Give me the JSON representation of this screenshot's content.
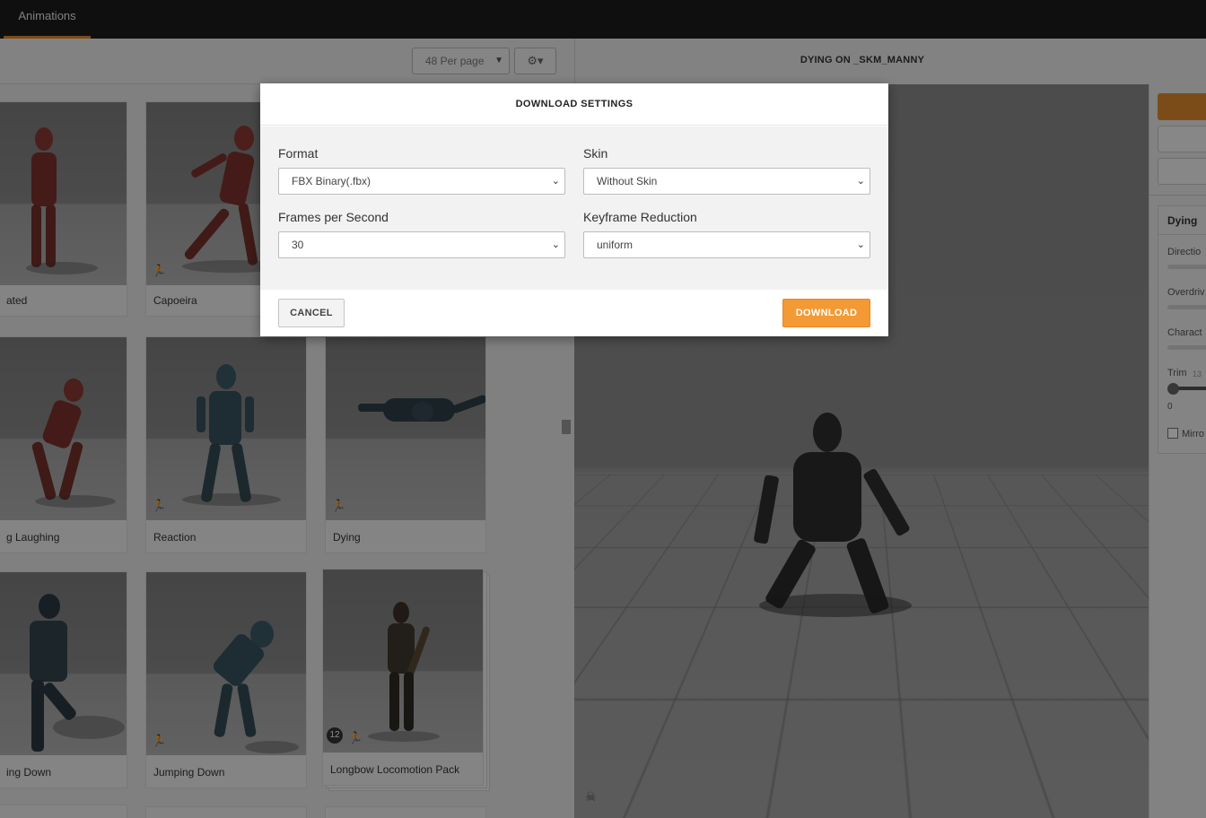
{
  "topbar": {
    "active_tab": "Animations"
  },
  "toolbar": {
    "per_page": "48 Per page",
    "settings_icon": "gear-icon"
  },
  "gallery": {
    "cards": [
      {
        "label": "ated",
        "icon": "run-icon"
      },
      {
        "label": "Capoeira",
        "icon": "run-icon"
      },
      {
        "label": "g Laughing",
        "icon": "run-icon"
      },
      {
        "label": "Reaction",
        "icon": "run-icon"
      },
      {
        "label": "Dying",
        "icon": "run-icon"
      },
      {
        "label": "ing Down",
        "icon": "run-icon"
      },
      {
        "label": "Jumping Down",
        "icon": "run-icon"
      },
      {
        "label": "Longbow Locomotion Pack",
        "count": "12",
        "icon": "run-icon"
      }
    ]
  },
  "viewport": {
    "title": "DYING ON _SKM_MANNY"
  },
  "right_panel": {
    "section_title": "Dying",
    "labels": [
      "Directio",
      "Overdriv",
      "Charact",
      "Trim",
      "Mirro"
    ],
    "trim_hint": "13",
    "trim_value": "0"
  },
  "modal": {
    "title": "DOWNLOAD SETTINGS",
    "fields": {
      "format": {
        "label": "Format",
        "value": "FBX Binary(.fbx)"
      },
      "skin": {
        "label": "Skin",
        "value": "Without Skin"
      },
      "fps": {
        "label": "Frames per Second",
        "value": "30"
      },
      "keyframe": {
        "label": "Keyframe Reduction",
        "value": "uniform"
      }
    },
    "cancel_label": "CANCEL",
    "download_label": "DOWNLOAD"
  },
  "colors": {
    "accent": "#f39a34",
    "topbar": "#1c1c1c"
  }
}
